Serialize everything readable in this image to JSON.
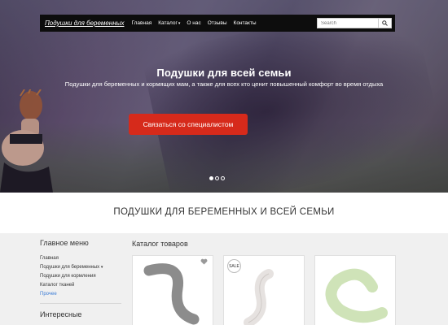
{
  "navbar": {
    "brand": "Подушки для беременных",
    "items": [
      {
        "label": "Главная",
        "caret": false
      },
      {
        "label": "Каталог",
        "caret": true
      },
      {
        "label": "О нас",
        "caret": false
      },
      {
        "label": "Отзывы",
        "caret": false
      },
      {
        "label": "Контакты",
        "caret": false
      }
    ],
    "search_placeholder": "Search",
    "search_icon": "search-icon"
  },
  "hero": {
    "title": "Подушки для всей семьи",
    "subtitle": "Подушки для беременных и кормящих мам, а также для всех кто ценит повышенный комфорт во время отдыха",
    "cta_label": "Связаться со специалистом",
    "slides_total": 3,
    "active_slide": 1,
    "cta_color": "#d62a1b"
  },
  "section": {
    "title": "ПОДУШКИ ДЛЯ БЕРЕМЕННЫХ И ВСЕЙ СЕМЬИ"
  },
  "sidebar": {
    "heading": "Главное меню",
    "items": [
      {
        "label": "Главная",
        "caret": false
      },
      {
        "label": "Подушки для беременных",
        "caret": true
      },
      {
        "label": "Подушки для кормления",
        "caret": false
      },
      {
        "label": "Каталог тканей",
        "caret": false
      }
    ],
    "more_label": "Прочее",
    "heading_2": "Интересные"
  },
  "catalog": {
    "title": "Каталог товаров",
    "products": [
      {
        "color": "#8c8c8c",
        "favorite_icon": "heart-icon"
      },
      {
        "color": "#e6e2e0",
        "badge": "SALE"
      },
      {
        "color": "#cfe3b8"
      }
    ]
  },
  "colors": {
    "navbar_bg": "#0d0d0d",
    "link": "#3a7bd5"
  }
}
